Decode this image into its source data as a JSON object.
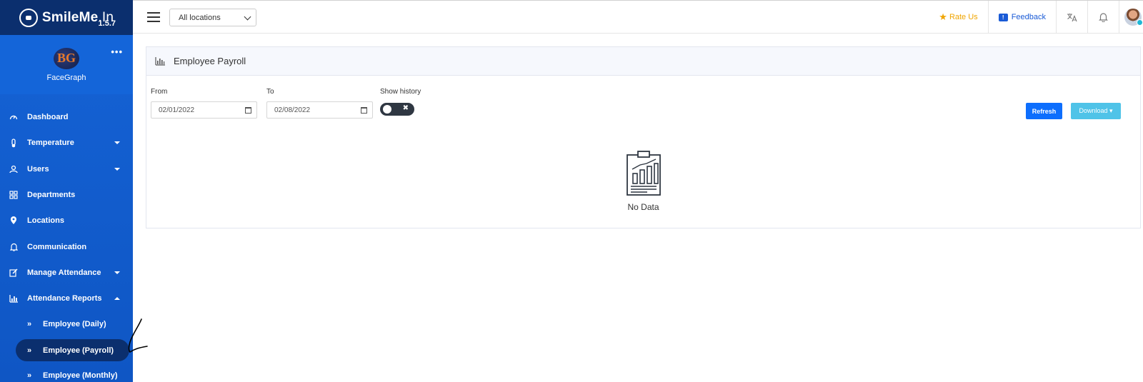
{
  "brand": {
    "name_bold": "SmileMe",
    "name_light": ".In",
    "version": "1.5.7"
  },
  "org": {
    "logo_text": "BG",
    "name": "FaceGraph",
    "more": "•••"
  },
  "sidebar": {
    "items": [
      {
        "label": "Dashboard",
        "icon": "dashboard-icon",
        "caret": false
      },
      {
        "label": "Temperature",
        "icon": "thermometer-icon",
        "caret": true
      },
      {
        "label": "Users",
        "icon": "users-icon",
        "caret": true
      },
      {
        "label": "Departments",
        "icon": "grid-icon",
        "caret": false
      },
      {
        "label": "Locations",
        "icon": "location-pin-icon",
        "caret": false
      },
      {
        "label": "Communication",
        "icon": "bell-icon",
        "caret": false
      },
      {
        "label": "Manage Attendance",
        "icon": "edit-icon",
        "caret": true
      },
      {
        "label": "Attendance Reports",
        "icon": "bar-chart-icon",
        "caret": "up"
      }
    ],
    "sub_items": [
      {
        "label": "Employee (Daily)",
        "active": false
      },
      {
        "label": "Employee (Payroll)",
        "active": true
      },
      {
        "label": "Employee (Monthly)",
        "active": false
      }
    ]
  },
  "topbar": {
    "location_select": "All locations",
    "rate_us": "Rate Us",
    "feedback": "Feedback"
  },
  "report": {
    "title": "Employee Payroll",
    "from_label": "From",
    "from_value": "02/01/2022",
    "to_label": "To",
    "to_value": "02/08/2022",
    "history_label": "Show history",
    "history_enabled": false,
    "refresh_label": "Refresh",
    "download_label": "Download",
    "empty_text": "No Data"
  },
  "colors": {
    "sidebar": "#1563d6",
    "sidebar_dark": "#0b2f6e",
    "primary_button": "#0d6efd",
    "download_button": "#4fc3e8",
    "rate_us": "#f0a500",
    "feedback": "#1a5bd6"
  }
}
